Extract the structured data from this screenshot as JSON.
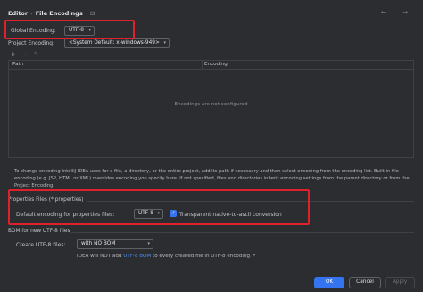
{
  "header": {
    "crumb_parent": "Editor",
    "crumb_sep": "›",
    "crumb_current": "File Encodings",
    "pin_icon": "⊟",
    "nav_arrows": "← →"
  },
  "global_encoding": {
    "label": "Global Encoding:",
    "value": "UTF-8"
  },
  "project_encoding": {
    "label": "Project Encoding:",
    "value": "<System Default: x-windows-949>"
  },
  "toolbar": {
    "add": "+",
    "remove": "−",
    "edit": "✎"
  },
  "table": {
    "columns": [
      "Path",
      "Encoding"
    ],
    "empty_text": "Encodings are not configured"
  },
  "description": "To change encoding IntelliJ IDEA uses for a file, a directory, or the entire project, add its path if necessary and then select encoding from the encoding list. Built-in file encoding (e.g. JSP, HTML or XML) overrides encoding you specify here. If not specified, files and directories inherit encoding settings from the parent directory or from the Project Encoding.",
  "properties": {
    "title": "Properties Files (*.properties)",
    "default_label": "Default encoding for properties files:",
    "default_value": "UTF-8",
    "transparent_label": "Transparent native-to-ascii conversion",
    "transparent_checked": true
  },
  "bom": {
    "title": "BOM for new UTF-8 files",
    "create_label": "Create UTF-8 files:",
    "create_value": "with NO BOM",
    "note_prefix": "IDEA will NOT add ",
    "note_link": "UTF-8 BOM",
    "note_suffix": " to every created file in UTF-8 encoding ↗"
  },
  "buttons": {
    "ok": "OK",
    "cancel": "Cancel",
    "apply": "Apply"
  },
  "colors": {
    "accent": "#3574f0",
    "highlight_box": "#e0202a",
    "link": "#4e8ff7"
  }
}
